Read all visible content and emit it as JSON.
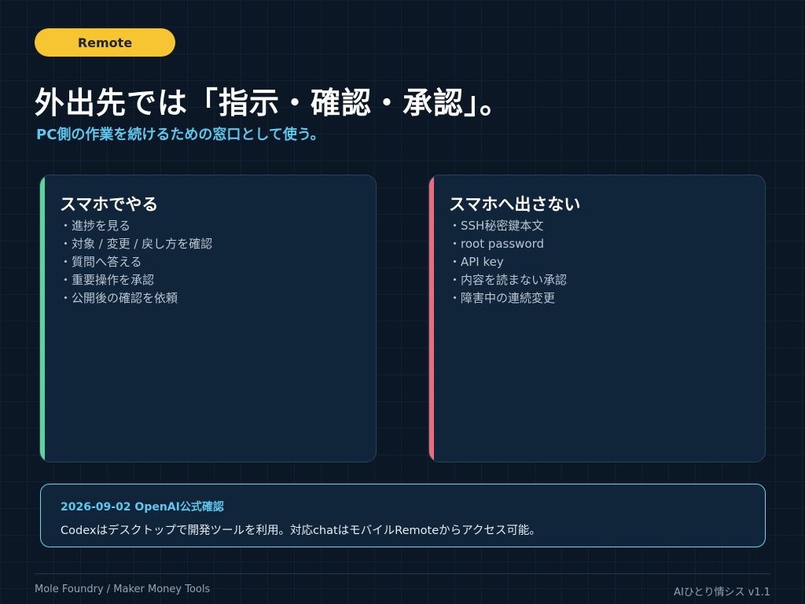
{
  "badge": {
    "label": "Remote"
  },
  "header": {
    "title": "外出先では「指示・確認・承認」。",
    "subtitle": "PC側の作業を続けるための窓口として使う。"
  },
  "cards": [
    {
      "heading": "スマホでやる",
      "accent_color": "#5fd39a",
      "items": [
        "進捗を見る",
        "対象 / 変更 / 戻し方を確認",
        "質問へ答える",
        "重要操作を承認",
        "公開後の確認を依頼"
      ]
    },
    {
      "heading": "スマホへ出さない",
      "accent_color": "#ef6b7b",
      "items": [
        "SSH秘密鍵本文",
        "root password",
        "API key",
        "内容を読まない承認",
        "障害中の連続変更"
      ]
    }
  ],
  "note": {
    "title": "2026-09-02 OpenAI公式確認",
    "body": "Codexはデスクトップで開発ツールを利用。対応chatはモバイルRemoteからアクセス可能。"
  },
  "footer": {
    "left": "Mole Foundry / Maker Money Tools",
    "right": "AIひとり情シス v1.1"
  },
  "colors": {
    "background": "#0b1724",
    "badge": "#f7c531",
    "accent_blue": "#5fc8ee",
    "card_bg": "#10243a"
  }
}
